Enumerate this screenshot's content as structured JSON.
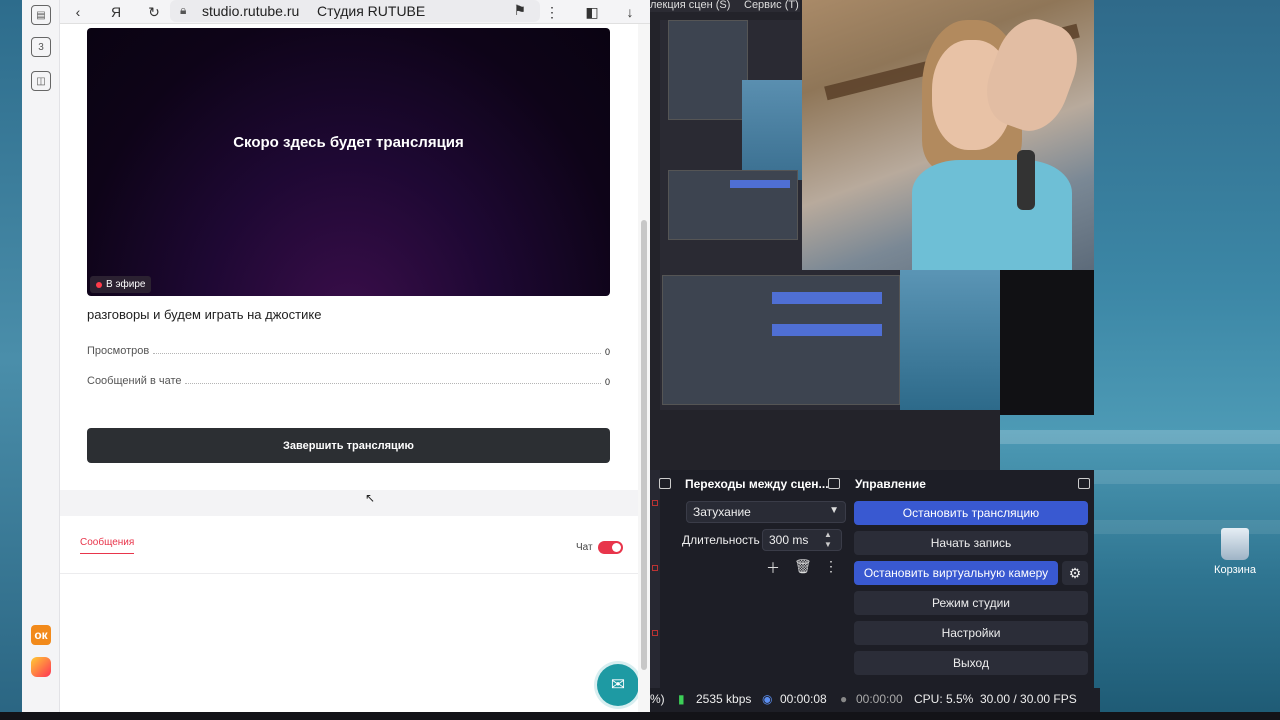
{
  "browser": {
    "domain": "studio.rutube.ru",
    "tab_title": "Студия RUTUBE",
    "side_panel": [
      "3"
    ],
    "side_ok": "ок"
  },
  "page": {
    "player_text": "Скоро здесь будет трансляция",
    "live_badge": "В эфире",
    "stream_title": "разговоры и будем играть на джостике",
    "stats": [
      {
        "label": "Просмотров",
        "value": "0"
      },
      {
        "label": "Сообщений в чате",
        "value": "0"
      }
    ],
    "end_button": "Завершить трансляцию",
    "tab_messages": "Сообщения",
    "chat_label": "Чат",
    "chat_enabled": true
  },
  "obs": {
    "menu": [
      "лекция сцен (S)",
      "Сервис (T)"
    ],
    "transitions": {
      "title": "Переходы между сцен...",
      "type": "Затухание",
      "duration_label": "Длительность",
      "duration_value": "300 ms"
    },
    "controls": {
      "title": "Управление",
      "buttons": [
        {
          "label": "Остановить трансляцию",
          "active": true
        },
        {
          "label": "Начать запись",
          "active": false
        },
        {
          "label": "Остановить виртуальную камеру",
          "active": true
        },
        {
          "label": "Режим студии",
          "active": false
        },
        {
          "label": "Настройки",
          "active": false
        },
        {
          "label": "Выход",
          "active": false
        }
      ]
    },
    "status": {
      "cpu_pct_prefix": "%)",
      "bitrate": "2535 kbps",
      "stream_time": "00:00:08",
      "rec_time": "00:00:00",
      "cpu": "CPU: 5.5%",
      "fps": "30.00 / 30.00 FPS"
    }
  },
  "desktop": {
    "recycle_bin": "Корзина"
  },
  "colors": {
    "accent_red": "#e8354b",
    "obs_blue": "#3959d1",
    "help_teal": "#1e9aa3"
  }
}
